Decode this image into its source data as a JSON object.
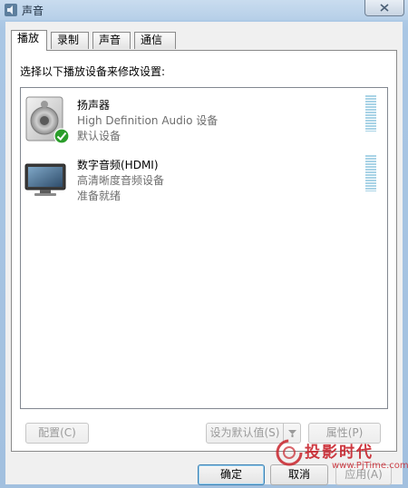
{
  "window": {
    "title": "声音"
  },
  "tabs": [
    {
      "label": "播放",
      "active": true
    },
    {
      "label": "录制",
      "active": false
    },
    {
      "label": "声音",
      "active": false
    },
    {
      "label": "通信",
      "active": false
    }
  ],
  "panel": {
    "instruction": "选择以下播放设备来修改设置:"
  },
  "devices": [
    {
      "name": "扬声器",
      "description": "High Definition Audio 设备",
      "status": "默认设备",
      "icon": "speaker-icon",
      "is_default": true
    },
    {
      "name": "数字音频(HDMI)",
      "description": "高清晰度音频设备",
      "status": "准备就绪",
      "icon": "monitor-icon",
      "is_default": false
    }
  ],
  "buttons": {
    "configure": "配置(C)",
    "set_default": "设为默认值(S)",
    "properties": "属性(P)",
    "ok": "确定",
    "cancel": "取消",
    "apply": "应用(A)"
  },
  "watermark": {
    "text": "投影时代",
    "url": "www.PjTime.com"
  },
  "colors": {
    "window_frame": "#a9c6e4",
    "dialog_bg": "#f0f0f0",
    "meter": "#a9d3e6",
    "default_check": "#2a9d2a",
    "watermark": "#c8232c"
  }
}
